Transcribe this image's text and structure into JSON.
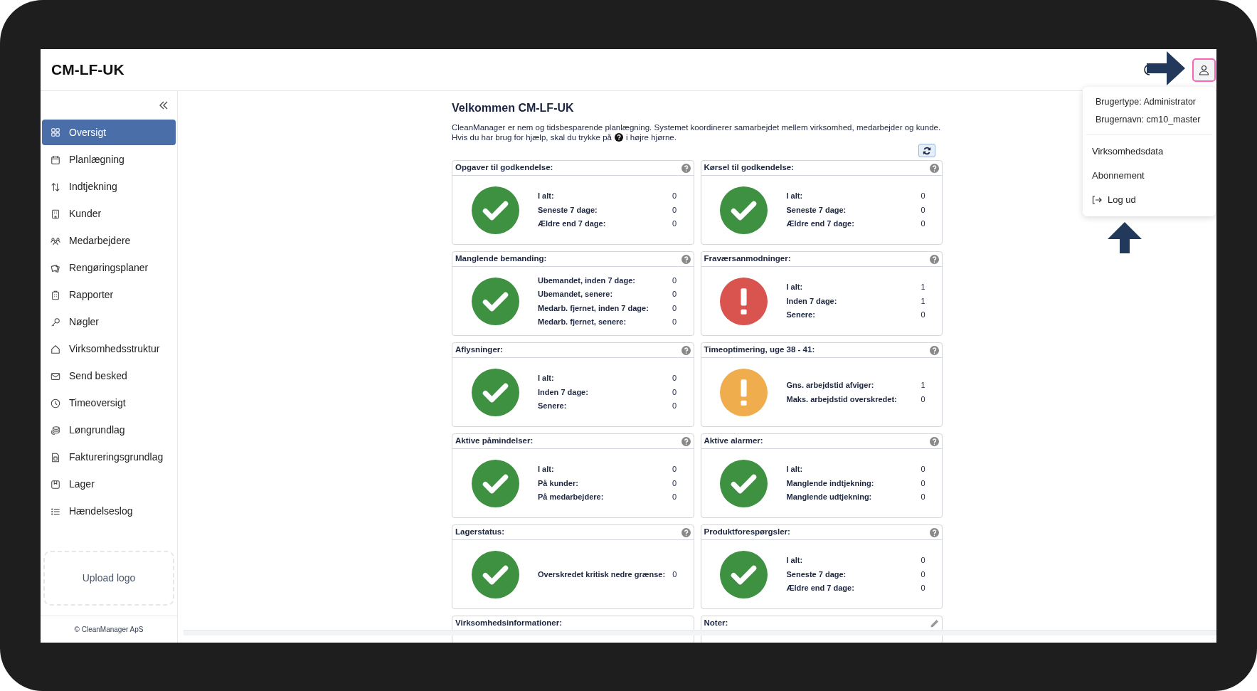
{
  "app_title": "CM-LF-UK",
  "user_menu": {
    "open": true,
    "info": [
      "Brugertype: Administrator",
      "Brugernavn: cm10_master"
    ],
    "items": [
      {
        "label": "Virksomhedsdata",
        "kind": "link"
      },
      {
        "label": "Abonnement",
        "kind": "link"
      },
      {
        "label": "Log ud",
        "kind": "logout"
      }
    ]
  },
  "sidebar": {
    "items": [
      {
        "label": "Oversigt",
        "selected": true
      },
      {
        "label": "Planlægning",
        "selected": false
      },
      {
        "label": "Indtjekning",
        "selected": false
      },
      {
        "label": "Kunder",
        "selected": false
      },
      {
        "label": "Medarbejdere",
        "selected": false
      },
      {
        "label": "Rengøringsplaner",
        "selected": false
      },
      {
        "label": "Rapporter",
        "selected": false
      },
      {
        "label": "Nøgler",
        "selected": false
      },
      {
        "label": "Virksomhedsstruktur",
        "selected": false
      },
      {
        "label": "Send besked",
        "selected": false
      },
      {
        "label": "Timeoversigt",
        "selected": false
      },
      {
        "label": "Løngrundlag",
        "selected": false
      },
      {
        "label": "Faktureringsgrundlag",
        "selected": false
      },
      {
        "label": "Lager",
        "selected": false
      },
      {
        "label": "Hændelseslog",
        "selected": false
      }
    ],
    "upload_logo": "Upload logo",
    "footer": "© CleanManager ApS"
  },
  "welcome": {
    "title": "Velkommen CM-LF-UK",
    "intro": "CleanManager er nem og tidsbesparende planlægning. Systemet koordinerer samarbejdet mellem virksomhed, medarbejder og kunde.",
    "help_before": "Hvis du har brug for hjælp, skal du trykke på",
    "help_after": "i højre hjørne."
  },
  "cards": [
    {
      "title": "Opgaver til godkendelse:",
      "help": true,
      "kind": "ok",
      "stats": [
        {
          "label": "I alt:",
          "value": "0"
        },
        {
          "label": "Seneste 7 dage:",
          "value": "0"
        },
        {
          "label": "Ældre end 7 dage:",
          "value": "0"
        }
      ]
    },
    {
      "title": "Kørsel til godkendelse:",
      "help": true,
      "kind": "ok",
      "stats": [
        {
          "label": "I alt:",
          "value": "0"
        },
        {
          "label": "Seneste 7 dage:",
          "value": "0"
        },
        {
          "label": "Ældre end 7 dage:",
          "value": "0"
        }
      ]
    },
    {
      "title": "Manglende bemanding:",
      "help": true,
      "kind": "ok",
      "stats": [
        {
          "label": "Ubemandet, inden 7 dage:",
          "value": "0"
        },
        {
          "label": "Ubemandet, senere:",
          "value": "0"
        },
        {
          "label": "Medarb. fjernet, inden 7 dage:",
          "value": "0"
        },
        {
          "label": "Medarb. fjernet, senere:",
          "value": "0"
        }
      ]
    },
    {
      "title": "Fraværsanmodninger:",
      "help": true,
      "kind": "error",
      "stats": [
        {
          "label": "I alt:",
          "value": "1"
        },
        {
          "label": "Inden 7 dage:",
          "value": "1"
        },
        {
          "label": "Senere:",
          "value": "0"
        }
      ]
    },
    {
      "title": "Aflysninger:",
      "help": true,
      "kind": "ok",
      "stats": [
        {
          "label": "I alt:",
          "value": "0"
        },
        {
          "label": "Inden 7 dage:",
          "value": "0"
        },
        {
          "label": "Senere:",
          "value": "0"
        }
      ]
    },
    {
      "title": "Timeoptimering, uge 38 - 41:",
      "help": true,
      "kind": "warning",
      "stats": [
        {
          "label": "Gns. arbejdstid afviger:",
          "value": "1"
        },
        {
          "label": "Maks. arbejdstid overskredet:",
          "value": "0"
        }
      ]
    },
    {
      "title": "Aktive påmindelser:",
      "help": true,
      "kind": "ok",
      "stats": [
        {
          "label": "I alt:",
          "value": "0"
        },
        {
          "label": "På kunder:",
          "value": "0"
        },
        {
          "label": "På medarbejdere:",
          "value": "0"
        }
      ]
    },
    {
      "title": "Aktive alarmer:",
      "help": true,
      "kind": "ok",
      "stats": [
        {
          "label": "I alt:",
          "value": "0"
        },
        {
          "label": "Manglende indtjekning:",
          "value": "0"
        },
        {
          "label": "Manglende udtjekning:",
          "value": "0"
        }
      ]
    },
    {
      "title": "Lagerstatus:",
      "help": true,
      "kind": "ok",
      "stats": [
        {
          "label": "Overskredet kritisk nedre grænse:",
          "value": "0"
        }
      ]
    },
    {
      "title": "Produktforespørgsler:",
      "help": true,
      "kind": "ok",
      "stats": [
        {
          "label": "I alt:",
          "value": "0"
        },
        {
          "label": "Seneste 7 dage:",
          "value": "0"
        },
        {
          "label": "Ældre end 7 dage:",
          "value": "0"
        }
      ]
    },
    {
      "title": "Virksomhedsinformationer:",
      "kind": "text"
    },
    {
      "title": "Noter:",
      "kind": "text",
      "editable": true
    }
  ]
}
